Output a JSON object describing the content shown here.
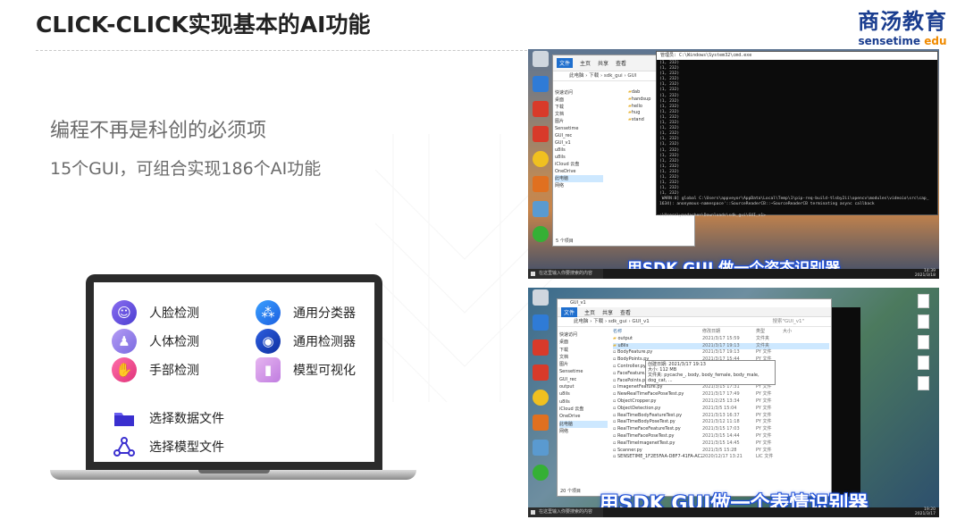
{
  "title": "CLICK-CLICK实现基本的AI功能",
  "logo": {
    "cn": "商汤教育",
    "en_main": "sensetime",
    "en_accent": "edu"
  },
  "subtitle1": "编程不再是科创的必须项",
  "subtitle2": "15个GUI，可组合实现186个AI功能",
  "features": {
    "face": "人脸检测",
    "body": "人体检测",
    "hand": "手部检测",
    "classifier": "通用分类器",
    "detector": "通用检测器",
    "visual": "模型可视化",
    "select_data": "选择数据文件",
    "select_model": "选择模型文件"
  },
  "icons": {
    "face": "face-scan-icon",
    "body": "person-icon",
    "hand": "hand-icon",
    "classifier": "network-icon",
    "detector": "eye-icon",
    "visual": "bar-chart-icon",
    "folder": "folder-icon",
    "model": "graph-nodes-icon"
  },
  "screenshot1": {
    "cmd_title": "管理员: C:\\Windows\\System32\\cmd.exe",
    "cmd_lines": "(1, 232)\n(1, 232)\n(1, 232)\n(1, 232)\n(1, 232)\n(1, 232)\n(1, 232)\n(1, 232)\n(1, 232)\n(1, 232)\n(1, 232)\n(1, 232)\n(1, 232)\n(1, 232)\n(1, 232)\n(1, 232)\n(1, 232)\n(1, 232)\n(1, 232)\n(1, 232)\n(1, 232)\n(1, 232)\n(1, 232)\n(1, 232)\n(1, 232)\n WARN:0] global C:\\Users\\appveyor\\AppData\\Local\\Temp\\1\\pip-req-build-tlsby2ii\\opencv\\modules\\videoio\\src\\cap_\n1634): anonymous-namespace'::SourceReaderCB::~SourceReaderCB terminating async callback\n\n:\\Users\\yaodachen\\Downloads\\sdk_gui\\GUI_v1>",
    "ribbon": [
      "文件",
      "主页",
      "共享",
      "查看"
    ],
    "address": "此电脑 › 下载 › sdk_gui › GUI",
    "nav": [
      "快速访问",
      "桌面",
      "下载",
      "文档",
      "图片",
      "Sensetime",
      "GUI_rec",
      "GUI_v1",
      "u8ils",
      "u8ils",
      "iCloud 云盘",
      "OneDrive",
      "此电脑",
      "网络"
    ],
    "files": [
      "dab",
      "handsup",
      "hello",
      "hug",
      "stand"
    ],
    "status": "5 个项目",
    "taskbar_search": "在这里输入你要搜索的内容",
    "clock_time": "14:39",
    "clock_date": "2021/3/18",
    "caption": "用SDK GUI 做一个姿态识别器"
  },
  "screenshot2": {
    "window_title": "GUI_v1",
    "ribbon": [
      "文件",
      "主页",
      "共享",
      "查看"
    ],
    "address": "此电脑 › 下载 › sdk_gui › GUI_v1",
    "search_placeholder": "搜索\"GUI_v1\"",
    "headers": {
      "name": "名称",
      "date": "修改日期",
      "type": "类型",
      "size": "大小"
    },
    "nav": [
      "快速访问",
      "桌面",
      "下载",
      "文档",
      "图片",
      "Sensetime",
      "GUI_rec",
      "output",
      "u8ils",
      "u8ils",
      "iCloud 云盘",
      "OneDrive",
      "此电脑",
      "网络"
    ],
    "files": [
      {
        "name": "output",
        "date": "2021/3/17 15:59",
        "type": "文件夹"
      },
      {
        "name": "u8ils",
        "date": "2021/3/17 19:13",
        "type": "文件夹"
      },
      {
        "name": "BodyFeature.py",
        "date": "2021/3/17 19:13",
        "type": "PY 文件"
      },
      {
        "name": "BodyPoints.py",
        "date": "2021/3/17 15:44",
        "type": "PY 文件"
      },
      {
        "name": "Controller.py",
        "date": "2021/3/17 13:23",
        "type": "PY 文件"
      },
      {
        "name": "FaceFeature.py",
        "date": "2021/3/15 15:36",
        "type": "PY 文件"
      },
      {
        "name": "FacePoints.py",
        "date": "2021/3/15 15:09",
        "type": "PY 文件"
      },
      {
        "name": "ImagenetFeature.py",
        "date": "2021/3/15 17:31",
        "type": "PY 文件"
      },
      {
        "name": "NewRealTimeFacePoseTest.py",
        "date": "2021/3/17 17:49",
        "type": "PY 文件"
      },
      {
        "name": "ObjectCropper.py",
        "date": "2021/2/25 13:34",
        "type": "PY 文件"
      },
      {
        "name": "ObjectDetection.py",
        "date": "2021/3/5 15:04",
        "type": "PY 文件"
      },
      {
        "name": "RealTimeBodyFeatureTest.py",
        "date": "2021/3/13 16:37",
        "type": "PY 文件"
      },
      {
        "name": "RealTimeBodyPoseTest.py",
        "date": "2021/3/12 11:18",
        "type": "PY 文件"
      },
      {
        "name": "RealTimeFaceFeatureTest.py",
        "date": "2021/3/15 17:03",
        "type": "PY 文件"
      },
      {
        "name": "RealTimeFacePoseTest.py",
        "date": "2021/3/15 14:44",
        "type": "PY 文件"
      },
      {
        "name": "RealTimeImagenetTest.py",
        "date": "2021/3/15 14:45",
        "type": "PY 文件"
      },
      {
        "name": "Scanner.py",
        "date": "2021/3/5 15:28",
        "type": "PY 文件"
      },
      {
        "name": "SENSETIME_1F2E5FAA-D8F7-41FA-AC2A-...",
        "date": "2020/12/17 13:21",
        "type": "LIC 文件"
      }
    ],
    "tooltip": [
      "创建日期: 2021/3/17 19:13",
      "大小: 112 MB",
      "文件夹: pycache_, body, body_female, body_male, dog_cat, ..."
    ],
    "status": "20 个项目",
    "taskbar_search": "在这里输入你要搜索的内容",
    "clock_time": "19:20",
    "clock_date": "2021/3/17",
    "caption": "用SDK GUI做一个表情识别器"
  }
}
